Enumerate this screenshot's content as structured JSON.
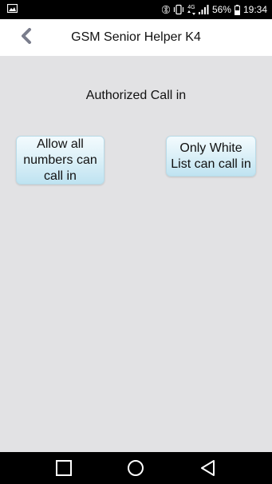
{
  "status_bar": {
    "battery": "56%",
    "time": "19:34",
    "network": "4G"
  },
  "header": {
    "title": "GSM Senior Helper K4"
  },
  "main": {
    "heading": "Authorized Call in",
    "options": [
      {
        "label": "Allow all numbers can call in"
      },
      {
        "label": "Only White List can call in"
      }
    ]
  },
  "colors": {
    "background": "#e2e2e4",
    "header": "#ffffff",
    "button_gradient_top": "#f3fbfe",
    "button_gradient_bottom": "#bfe3f1",
    "back_arrow": "#7a7d8c"
  },
  "icons": {
    "status": [
      "image-icon",
      "bluetooth-icon",
      "vibrate-icon",
      "network-4g-icon",
      "signal-icon",
      "battery-icon"
    ],
    "nav": [
      "recents-icon",
      "home-icon",
      "back-nav-icon"
    ]
  }
}
